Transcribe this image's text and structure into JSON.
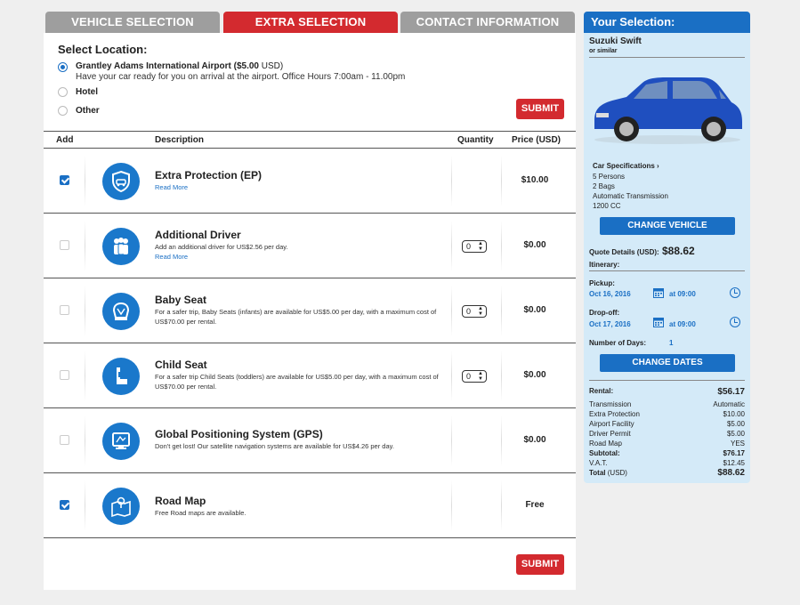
{
  "tabs": [
    {
      "label": "VEHICLE SELECTION"
    },
    {
      "label": "EXTRA SELECTION"
    },
    {
      "label": "CONTACT INFORMATION"
    }
  ],
  "location": {
    "title": "Select Location:",
    "options": [
      {
        "label": "Grantley Adams International Airport",
        "price": "($5.00",
        "currency": "USD)",
        "sub": "Have your car ready for you on arrival at the airport. Office Hours 7:00am - 11.00pm",
        "selected": true
      },
      {
        "label": "Hotel",
        "selected": false
      },
      {
        "label": "Other",
        "selected": false
      }
    ],
    "submit_label": "SUBMIT"
  },
  "table": {
    "headers": {
      "add": "Add",
      "description": "Description",
      "quantity": "Quantity",
      "price": "Price (USD)"
    },
    "rows": [
      {
        "title": "Extra Protection (EP)",
        "desc": "",
        "link": "Read More",
        "qty": "",
        "price": "$10.00",
        "checked": true,
        "icon": "shield-car-icon"
      },
      {
        "title": "Additional Driver",
        "desc": "Add an additional driver for US$2.56 per day.",
        "link": "Read More",
        "qty": "0",
        "price": "$0.00",
        "checked": false,
        "icon": "drivers-icon"
      },
      {
        "title": "Baby Seat",
        "desc": "For a safer trip, Baby Seats (infants) are available for US$5.00 per day, with a maximum cost of US$70.00 per rental.",
        "link": "",
        "qty": "0",
        "price": "$0.00",
        "checked": false,
        "icon": "baby-seat-icon"
      },
      {
        "title": "Child Seat",
        "desc": "For a safer trip Child Seats (toddlers) are available for US$5.00 per day, with a maximum cost of US$70.00 per rental.",
        "link": "",
        "qty": "0",
        "price": "$0.00",
        "checked": false,
        "icon": "child-seat-icon"
      },
      {
        "title": "Global Positioning System (GPS)",
        "desc": "Don't get lost! Our satellite navigation systems are available for US$4.26 per day.",
        "link": "",
        "qty": "",
        "price": "$0.00",
        "checked": false,
        "icon": "gps-icon"
      },
      {
        "title": "Road Map",
        "desc": "Free Road maps are available.",
        "link": "",
        "qty": "",
        "price": "Free",
        "checked": true,
        "icon": "road-map-icon"
      }
    ],
    "submit_label": "SUBMIT"
  },
  "sidebar": {
    "title": "Your Selection:",
    "car_name": "Suzuki Swift",
    "car_sub": "or similar",
    "spec_title": "Car Specifications ›",
    "specs": [
      "5 Persons",
      "2 Bags",
      "Automatic Transmission",
      "1200 CC"
    ],
    "change_vehicle": "CHANGE VEHICLE",
    "quote_label": "Quote Details (USD):",
    "quote_value": "$88.62",
    "itinerary": "Itinerary:",
    "pickup_label": "Pickup:",
    "pickup_date": "Oct 16, 2016",
    "pickup_time": "at 09:00",
    "dropoff_label": "Drop-off:",
    "dropoff_date": "Oct 17, 2016",
    "dropoff_time": "at 09:00",
    "days_label": "Number of Days:",
    "days_value": "1",
    "change_dates": "CHANGE DATES",
    "costs": [
      {
        "label": "Rental:",
        "value": "$56.17",
        "bold": true
      },
      {
        "label": "Transmission",
        "value": "Automatic"
      },
      {
        "label": "Extra Protection",
        "value": "$10.00"
      },
      {
        "label": "Airport Facility",
        "value": "$5.00"
      },
      {
        "label": "Driver Permit",
        "value": "$5.00"
      },
      {
        "label": "Road Map",
        "value": "YES"
      },
      {
        "label": "Subtotal:",
        "value": "$76.17",
        "bold": true
      },
      {
        "label": "V.A.T.",
        "value": "$12.45"
      },
      {
        "label": "Total",
        "label_suffix": "(USD)",
        "value": "$88.62",
        "bold": true
      }
    ]
  },
  "colors": {
    "accent_red": "#d32a2f",
    "accent_blue": "#1a6fc4",
    "tab_grey": "#9e9e9e",
    "sidebar_bg": "#d4eaf8"
  }
}
